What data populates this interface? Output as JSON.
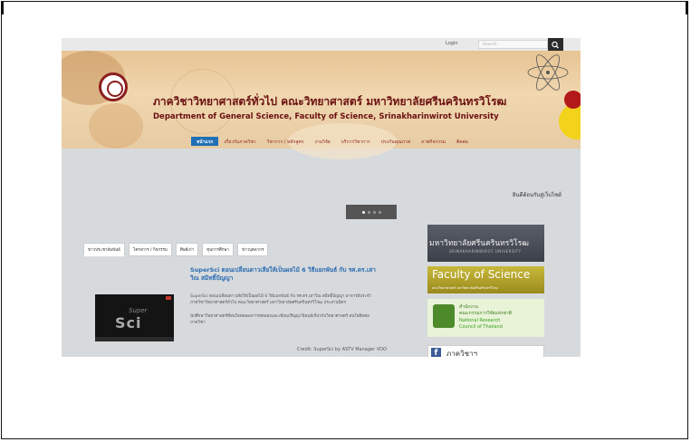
{
  "topbar": {
    "login_label": "Login",
    "search_placeholder": "Search"
  },
  "header": {
    "thai_title": "ภาควิชาวิทยาศาสตร์ทั่วไป คณะวิทยาศาสตร์ มหาวิทยาลัยศรีนครินทรวิโรฒ",
    "english_title": "Department of General Science, Faculty of Science, Srinakharinwirot University"
  },
  "nav": {
    "items": [
      "หน้าแรก",
      "เกี่ยวกับภาควิชา",
      "วิชาการ / หลักสูตร",
      "งานวิจัย",
      "บริการวิชาการ",
      "ประกันคุณภาพ",
      "ภาพกิจกรรม",
      "ติดต่อ"
    ]
  },
  "welcome_text": "ยินดีต้อนรับสู่เว็บไซต์",
  "slider": {
    "dots": 4,
    "active": 1
  },
  "tabs": [
    "ข่าวประชาสัมพันธ์",
    "โครงการ / กิจกรรม",
    "ศิษย์เก่า",
    "ทุนการศึกษา",
    "ข่าวบุคลากร"
  ],
  "news": {
    "title": "SuperSci ตอนเปลี่ยนดาวเสียให้เป็นผลไม้ 6 วิธีแยกพันธ์ กับ รศ.ดร.เสาวิณ สมิทธิ์ปัญญา",
    "paragraph1": "SuperSci ตอนเปลี่ยนดาวเสียให้เป็นผลไม้ 6 วิธีแยกพันธ์ กับ รศ.ดร.เสาวิณ สมิทธิ์ปัญญา อาจารย์ประจำภาควิชาวิทยาศาสตร์ทั่วไป คณะวิทยาศาสตร์ มหาวิทยาลัยศรีนครินทรวิโรฒ ประสานมิตร",
    "paragraph2": "นักศึกษาวิทยาศาสตร์ที่สนใจทดลองการทดลองและเขียนปริญญานิพนธ์เกี่ยวกับวิทยาศาสตร์ สนใจติดต่อภาควิชา",
    "credit": "Credit: SuperSci by ASTV Manager VDO",
    "video_super": "Super",
    "video_sci": "Sci"
  },
  "sidebar": {
    "swu_thai": "มหาวิทยาลัยศรีนครินทรวิโรฒ",
    "swu_english": "SRINAKHARINWIROT UNIVERSITY",
    "fos_english": "Faculty of Science",
    "fos_thai": "คณะวิทยาศาสตร์ มหาวิทยาลัยศรีนครินทรวิโรฒ",
    "nrct_thai1": "สำนักงาน",
    "nrct_thai2": "คณะกรรมการวิจัยแห่งชาติ",
    "nrct_english1": "National Research",
    "nrct_english2": "Council of Thailand",
    "fb_icon": "f",
    "fb_text": "ภาควิชาฯ"
  },
  "colors": {
    "nav_active": "#1f6fb4",
    "header_text": "#6b1010",
    "news_title": "#2a6bb0"
  }
}
